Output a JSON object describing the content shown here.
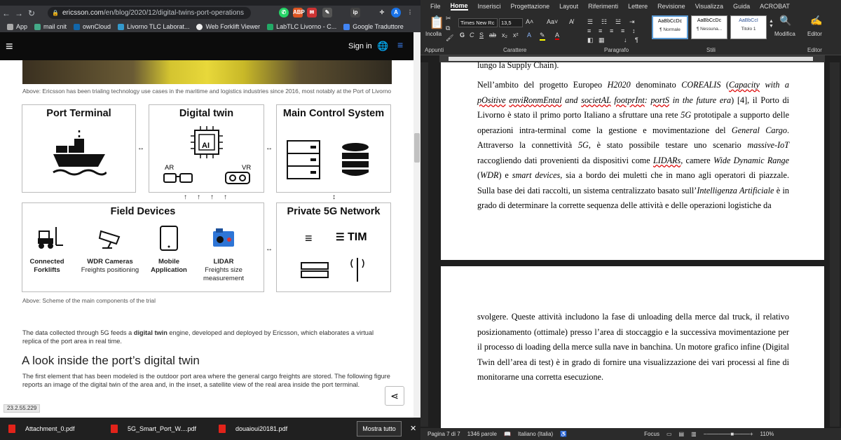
{
  "browser": {
    "url_domain": "ericsson.com",
    "url_path": "/en/blog/2020/12/digital-twins-port-operations",
    "bookmarks": [
      "App",
      "mail cnit",
      "ownCloud",
      "Livorno TLC Laborat...",
      "Web Forklift Viewer",
      "LabTLC Livorno - C...",
      "Google Traduttore"
    ],
    "sign_in": "Sign in",
    "caption1": "Above: Ericsson has been trialing technology use cases in the maritime and logistics industries since 2016, most notably at the Port of Livorno",
    "diagram": {
      "port_terminal": "Port Terminal",
      "digital_twin": "Digital twin",
      "ai": "AI",
      "ar": "AR",
      "vr": "VR",
      "main_control": "Main Control System",
      "field_devices": "Field Devices",
      "private_5g": "Private 5G Network",
      "tim": "TIM",
      "devices": [
        {
          "title": "Connected",
          "sub": "Forklifts"
        },
        {
          "title": "WDR Cameras",
          "sub": "Freights positioning"
        },
        {
          "title": "Mobile",
          "sub": "Application"
        },
        {
          "title": "LIDAR",
          "sub": "Freights size measurement"
        }
      ]
    },
    "caption2": "Above: Scheme of the main components of the trial",
    "para1_a": "The data collected through 5G feeds a ",
    "para1_b": "digital twin",
    "para1_c": " engine, developed and deployed by Ericsson, which elaborates a virtual replica of the port area in real time.",
    "heading": "A look inside the port’s digital twin",
    "para2": "The first element that has been modeled is the outdoor port area where the general cargo freights are stored. The following figure reports an image of the digital twin of the area and, in the inset, a satellite view of the real area inside the port terminal.",
    "status_url": "23.2.55.229"
  },
  "word": {
    "tabs": [
      "File",
      "Home",
      "Inserisci",
      "Progettazione",
      "Layout",
      "Riferimenti",
      "Lettere",
      "Revisione",
      "Visualizza",
      "Guida",
      "ACROBAT"
    ],
    "font": "Times New Rc",
    "size": "13,5",
    "groups": {
      "clipboard": "Appunti",
      "font": "Carattere",
      "paragraph": "Paragrafo",
      "styles": "Stili",
      "editor": "Editor"
    },
    "paste": "Incolla",
    "modify": "Modifica",
    "editor": "Editor",
    "styles": [
      {
        "sample": "AaBbCcDc",
        "name": "¶ Normale"
      },
      {
        "sample": "AaBbCcDc",
        "name": "¶ Nessuna..."
      },
      {
        "sample": "AaBbCcI",
        "name": "Titolo 1"
      }
    ],
    "page1_top": "lungo la Supply Chain).",
    "page2": "svolgere. Queste attività includono la fase di unloading della merce dal truck, il relativo posizionamento (ottimale) presso l’area di stoccaggio e la successiva movimentazione per il processo di loading della merce sulla nave in banchina. Un motore grafico infine (Digital Twin dell’area di test) è in grado di fornire una visualizzazione dei vari processi al fine di monitorarne una corretta esecuzione.",
    "status": {
      "page": "Pagina 7 di 7",
      "words": "1346 parole",
      "lang": "Italiano (Italia)",
      "focus": "Focus",
      "zoom": "110%"
    }
  },
  "taskbar": {
    "files": [
      "Attachment_0.pdf",
      "5G_Smart_Port_W....pdf",
      "douaioui20181.pdf"
    ],
    "show_all": "Mostra tutto"
  }
}
